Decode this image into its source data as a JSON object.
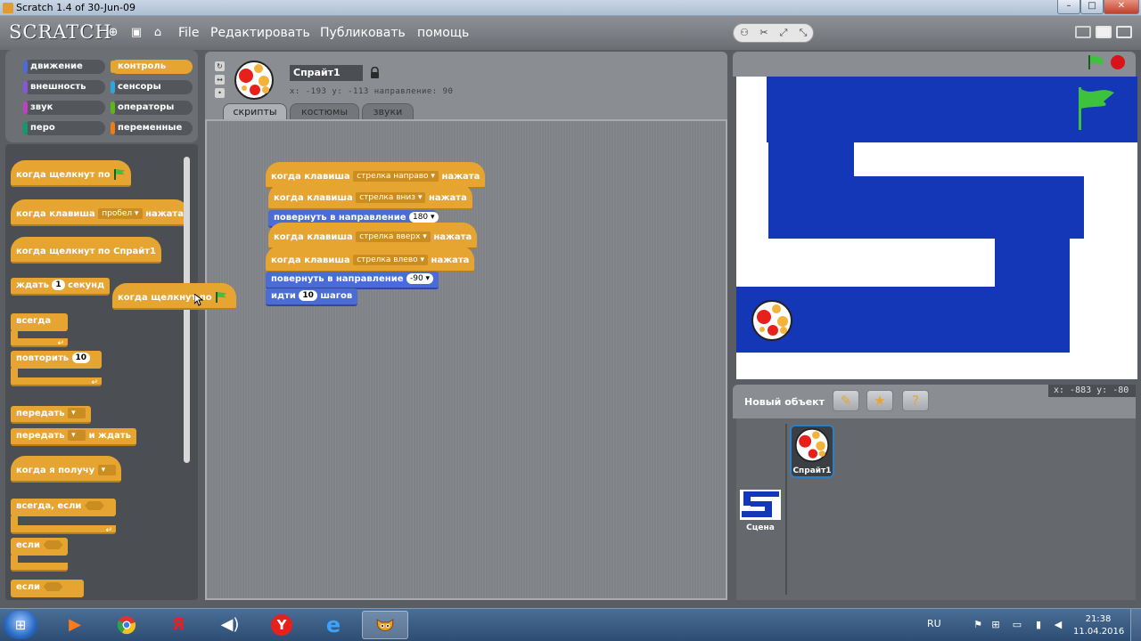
{
  "window": {
    "title": "Scratch 1.4 of 30-Jun-09",
    "controls": [
      "–",
      "□",
      "✕"
    ]
  },
  "menubar": {
    "logo": "SCRATCH",
    "items": [
      "File",
      "Редактировать",
      "Публиковать",
      "помощь"
    ]
  },
  "categories": {
    "left": [
      {
        "label": "движение",
        "color": "#4a6cd4"
      },
      {
        "label": "внешность",
        "color": "#8a55d7"
      },
      {
        "label": "звук",
        "color": "#bb42c3"
      },
      {
        "label": "перо",
        "color": "#0e9a6c"
      }
    ],
    "right": [
      {
        "label": "контроль",
        "color": "#e6a531",
        "selected": true
      },
      {
        "label": "сенсоры",
        "color": "#2ca5e2"
      },
      {
        "label": "операторы",
        "color": "#5cb712"
      },
      {
        "label": "переменные",
        "color": "#ee7d16"
      }
    ]
  },
  "palette": {
    "when_flag": "когда щелкнут по",
    "when_key": "когда клавиша",
    "key_value": "пробел",
    "pressed": "нажата",
    "when_sprite_clicked": "когда щелкнут по  Спрайт1",
    "wait": "ждать",
    "wait_value": "1",
    "seconds": "секунд",
    "forever": "всегда",
    "repeat": "повторить",
    "repeat_value": "10",
    "broadcast": "передать",
    "broadcast_wait": "передать",
    "and_wait": "и ждать",
    "when_receive": "когда я получу",
    "forever_if": "всегда, если",
    "if1": "если",
    "if2": "если"
  },
  "dragged_block": {
    "label": "когда щелкнут по"
  },
  "sprite": {
    "name": "Спрайт1",
    "coords": "x: -193  y: -113  направление: 90"
  },
  "tabs": [
    "скрипты",
    "костюмы",
    "звуки"
  ],
  "scripts": {
    "s1": {
      "when": "когда клавиша",
      "key": "стрелка направо",
      "pressed": "нажата"
    },
    "s2": {
      "when": "когда клавиша",
      "key": "стрелка вниз",
      "pressed": "нажата"
    },
    "s2_point": {
      "label": "повернуть в направление",
      "value": "180"
    },
    "s3": {
      "when": "когда клавиша",
      "key": "стрелка вверх",
      "pressed": "нажата"
    },
    "s4": {
      "when": "когда клавиша",
      "key": "стрелка влево",
      "pressed": "нажата"
    },
    "s4_point": {
      "label": "повернуть в направление",
      "value": "-90"
    },
    "s4_move": {
      "label1": "идти",
      "value": "10",
      "label2": "шагов"
    }
  },
  "stage": {
    "mouse_coords": "x: -883  y: -80",
    "wall_color": "#1437b8",
    "flag_color": "#3ec23e"
  },
  "sprites_panel": {
    "new_object": "Новый объект",
    "sprite_label": "Спрайт1",
    "stage_label": "Сцена"
  },
  "taskbar": {
    "lang": "RU",
    "time": "21:38",
    "date": "11.04.2016",
    "apps": [
      "media-player-icon",
      "chrome-icon",
      "yandex-browser-icon",
      "speaker-app-icon",
      "yandex-y-icon",
      "internet-explorer-icon",
      "scratch-cat-icon"
    ]
  }
}
